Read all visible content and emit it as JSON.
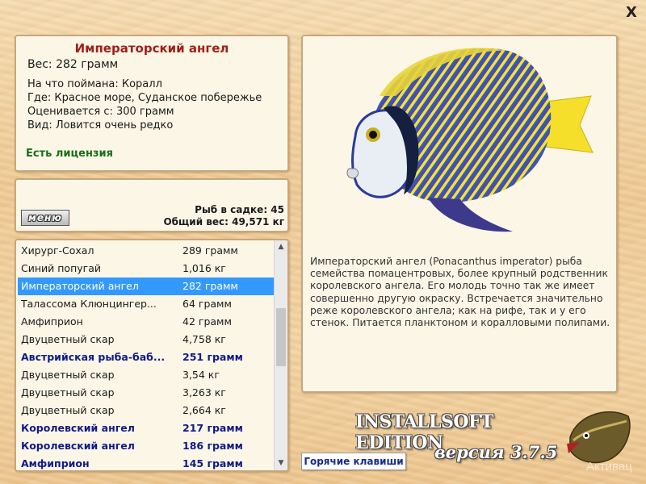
{
  "window": {
    "close_label": "X"
  },
  "info": {
    "fish_name": "Императорский ангел",
    "weight": "Вес: 282 грамм",
    "caught_on": "На что поймана: Коралл",
    "location": "Где: Красное море, Суданское побережье",
    "valued_from": "Оценивается с: 300 грамм",
    "rarity": "Вид: Ловится очень редко",
    "license": "Есть лицензия"
  },
  "status": {
    "menu_label": "меню",
    "fish_in_keepnet": "Рыб в садке: 45",
    "total_weight": "Общий вес: 49,571 кг"
  },
  "catch_list": [
    {
      "name": "Хирург-Сохал",
      "weight": "289 грамм",
      "bold": false
    },
    {
      "name": "Синий попугай",
      "weight": "1,016 кг",
      "bold": false
    },
    {
      "name": "Императорский ангел",
      "weight": "282 грамм",
      "bold": false,
      "selected": true
    },
    {
      "name": "Талассома Клюнцингер...",
      "weight": "64 грамм",
      "bold": false
    },
    {
      "name": "Амфиприон",
      "weight": "42 грамм",
      "bold": false
    },
    {
      "name": "Двуцветный скар",
      "weight": "4,758 кг",
      "bold": false
    },
    {
      "name": "Австрийская рыба-баб...",
      "weight": "251 грамм",
      "bold": true
    },
    {
      "name": "Двуцветный скар",
      "weight": "3,54 кг",
      "bold": false
    },
    {
      "name": "Двуцветный скар",
      "weight": "3,263 кг",
      "bold": false
    },
    {
      "name": "Двуцветный скар",
      "weight": "2,664 кг",
      "bold": false
    },
    {
      "name": "Королевский ангел",
      "weight": "217 грамм",
      "bold": true
    },
    {
      "name": "Королевский ангел",
      "weight": "186 грамм",
      "bold": true
    },
    {
      "name": "Амфиприон",
      "weight": "145 грамм",
      "bold": true
    }
  ],
  "description": {
    "text": "Императорский ангел (Ponacanthus imperator) рыба семейства помацентровых, более крупный родственник королевского ангела. Его молодь точно так же имеет совершенно другую окраску. Встречается значительно реже королевского ангела; как на рифе, так и у его стенок. Питается планктоном и коралловыми полипами."
  },
  "footer": {
    "hotkeys_label": "Горячие клавиши",
    "edition": "INSTALLSOFT EDITION",
    "version": "версия 3.7.5",
    "activate": "Активац"
  },
  "colors": {
    "title_red": "#a02018",
    "license_green": "#1a6e1a",
    "bold_row_blue": "#111a8a",
    "selection_blue": "#3399ff"
  }
}
